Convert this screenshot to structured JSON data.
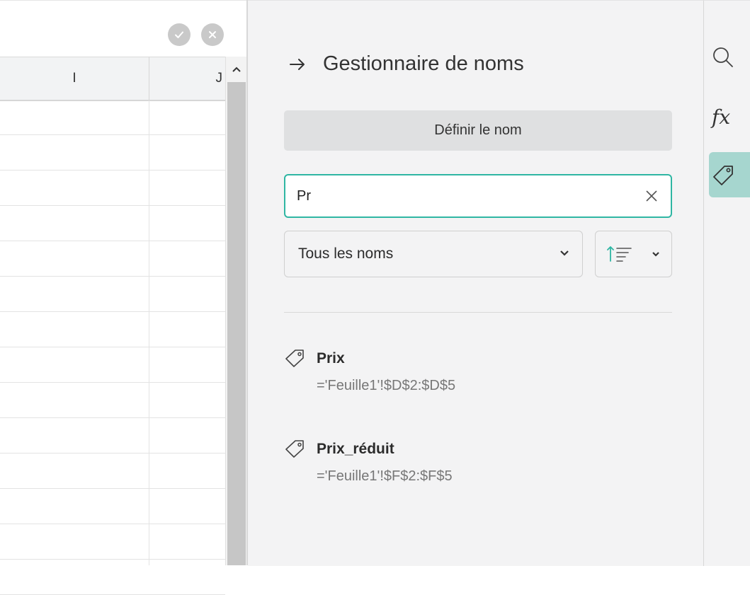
{
  "spreadsheet": {
    "column_headers": [
      "I",
      "J"
    ]
  },
  "panel": {
    "title": "Gestionnaire de noms",
    "define_button": "Définir le nom",
    "search": {
      "value": "Pr"
    },
    "filter": {
      "selected": "Tous les noms"
    },
    "names": [
      {
        "name": "Prix",
        "reference": "='Feuille1'!$D$2:$D$5"
      },
      {
        "name": "Prix_réduit",
        "reference": "='Feuille1'!$F$2:$F$5"
      }
    ]
  },
  "rail": {
    "fx_label": "fx"
  },
  "colors": {
    "accent": "#2fb6a3",
    "active_rail": "#a6d6cf",
    "panel_bg": "#f3f3f4"
  }
}
